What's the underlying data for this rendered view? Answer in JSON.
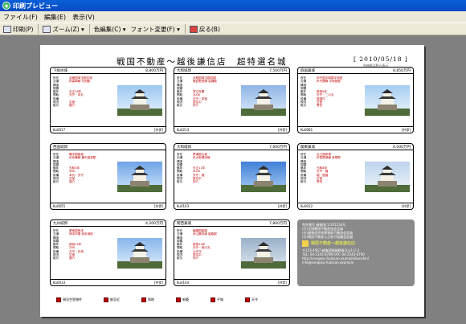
{
  "window": {
    "title": "印刷プレビュー"
  },
  "menu": [
    "ファイル(F)",
    "編集(E)",
    "表示(V)"
  ],
  "toolbar": {
    "print": "印刷(P)",
    "zoom": "ズーム(Z)",
    "color_edit": "色編集(C)",
    "font_change": "フォント変更(F)",
    "back": "戻る(B)"
  },
  "document": {
    "title": "戦国不動産～越後謙信店　超特選名城",
    "date": "[ 2010/05/18 ]",
    "sub": "※価格は税込表示"
  },
  "cards": [
    {
      "name": "下総古城",
      "price": "8,800万円",
      "code": "Ku0017",
      "tag": "[井伊]",
      "photo": "castle-1",
      "rows": [
        [
          "所在",
          "武蔵国埼玉郡忍城"
        ],
        [
          "交通",
          "JR高崎線 行田駅"
        ],
        [
          "構造",
          ""
        ],
        [
          "規模",
          ""
        ],
        [
          "築年",
          "天正18年"
        ],
        [
          "間取",
          "天守・本丸"
        ],
        [
          "設備",
          ""
        ],
        [
          "現況",
          "空室"
        ],
        [
          "取引",
          "媒介"
        ]
      ]
    },
    {
      "name": "大和城郭",
      "price": "7,500万円",
      "code": "Ku0213",
      "tag": "[井伊]",
      "photo": "castle-2",
      "rows": [
        [
          "所在",
          "武蔵国埼玉郡岩槻"
        ],
        [
          "交通",
          "東武野田線 岩槻駅"
        ],
        [
          "構造",
          ""
        ],
        [
          "規模",
          ""
        ],
        [
          "築年",
          "寛文年間"
        ],
        [
          "間取",
          "3LDK"
        ],
        [
          "設備",
          "天守・茶室"
        ],
        [
          "現況",
          "居住中"
        ],
        [
          "取引",
          "仲介"
        ]
      ]
    },
    {
      "name": "四国兼城",
      "price": "8,850万円",
      "code": "Ku0081",
      "tag": "[井伊]",
      "photo": "castle-3",
      "rows": [
        [
          "所在",
          "伊予国宇和郡宇和島"
        ],
        [
          "交通",
          "JR予讃線 宇和島駅"
        ],
        [
          "構造",
          ""
        ],
        [
          "規模",
          ""
        ],
        [
          "築年",
          "慶長6年"
        ],
        [
          "間取",
          "天守・二の丸"
        ],
        [
          "設備",
          "庭園付"
        ],
        [
          "現況",
          "空室"
        ],
        [
          "取引",
          "専任"
        ]
      ]
    },
    {
      "name": "西国城郭",
      "price": "",
      "code": "Ku0055",
      "tag": "[井伊]",
      "photo": "castle-4",
      "rows": [
        [
          "所在",
          "備中国高梁"
        ],
        [
          "交通",
          "JR伯備線 備中高梁駅"
        ],
        [
          "構造",
          ""
        ],
        [
          "規模",
          ""
        ],
        [
          "築年",
          "天和3年"
        ],
        [
          "間取",
          "5DK"
        ],
        [
          "設備",
          "本丸・天守"
        ],
        [
          "現況",
          "空室"
        ],
        [
          "取引",
          "媒介"
        ]
      ]
    },
    {
      "name": "大和城郭",
      "price": "7,600万円",
      "code": "Ku0163",
      "tag": "[井伊]",
      "photo": "castle-5",
      "rows": [
        [
          "所在",
          "摂津国大坂"
        ],
        [
          "交通",
          "JR大阪環状線"
        ],
        [
          "構造",
          ""
        ],
        [
          "規模",
          ""
        ],
        [
          "築年",
          "天正11年"
        ],
        [
          "間取",
          "3LDK"
        ],
        [
          "設備",
          "天守・堀"
        ],
        [
          "現況",
          "居住中"
        ],
        [
          "取引",
          "仲介"
        ]
      ]
    },
    {
      "name": "関東兼城",
      "price": "6,000万円",
      "code": "Ku0012",
      "tag": "[井伊]",
      "photo": "castle-6",
      "rows": [
        [
          "所在",
          "近江国彦根"
        ],
        [
          "交通",
          "JR琵琶湖線 彦根駅"
        ],
        [
          "構造",
          ""
        ],
        [
          "規模",
          ""
        ],
        [
          "築年",
          "元和8年"
        ],
        [
          "間取",
          "天守・櫓"
        ],
        [
          "設備",
          "堀・庭園"
        ],
        [
          "現況",
          "空室"
        ],
        [
          "取引",
          "専任"
        ]
      ]
    },
    {
      "name": "九州城郭",
      "price": "4,200万円",
      "code": "Ku0033",
      "tag": "[井伊]",
      "photo": "castle-7",
      "rows": [
        [
          "所在",
          "肥後国熊本"
        ],
        [
          "交通",
          "熊本市電 熊本城前"
        ],
        [
          "構造",
          ""
        ],
        [
          "規模",
          ""
        ],
        [
          "築年",
          "慶長12年"
        ],
        [
          "間取",
          "2DK"
        ],
        [
          "設備",
          "天守・石垣"
        ],
        [
          "現況",
          "空室"
        ],
        [
          "取引",
          "媒介"
        ]
      ]
    },
    {
      "name": "関西兼城",
      "price": "7,800万円",
      "code": "Ku0104",
      "tag": "[井伊]",
      "photo": "castle-8",
      "rows": [
        [
          "所在",
          "播磨国姫路"
        ],
        [
          "交通",
          "JR山陽本線 姫路駅"
        ],
        [
          "構造",
          ""
        ],
        [
          "規模",
          ""
        ],
        [
          "築年",
          "慶長14年"
        ],
        [
          "間取",
          "天守・西の丸"
        ],
        [
          "設備",
          "大天守"
        ],
        [
          "現況",
          "居住中"
        ],
        [
          "取引",
          "仲介"
        ]
      ]
    }
  ],
  "company": {
    "lines": [
      "免許番号 越後国(1)101234号",
      "(社)全国戦国不動産協会会員",
      "(社)越後国宅地建物取引業協会会員",
      "(社)戦国不動産公正取引協議会加盟"
    ],
    "name": "戦国不動産～越後謙信店",
    "address": "〒123-4567 越後国頸城郡春日山1-2-3",
    "tel": "TEL: 04-2345-6789  FAX: 04-2345-6790",
    "url": "http://sengoku-fudosan.example/kenshin/",
    "email": "info@sengoku-fudosan.example"
  },
  "legend": [
    "現況空室物件",
    "駅至近",
    "角地",
    "新築",
    "平城",
    "天守"
  ],
  "colors": {
    "accent": "#c00000",
    "panel": "#8a8a8a"
  }
}
